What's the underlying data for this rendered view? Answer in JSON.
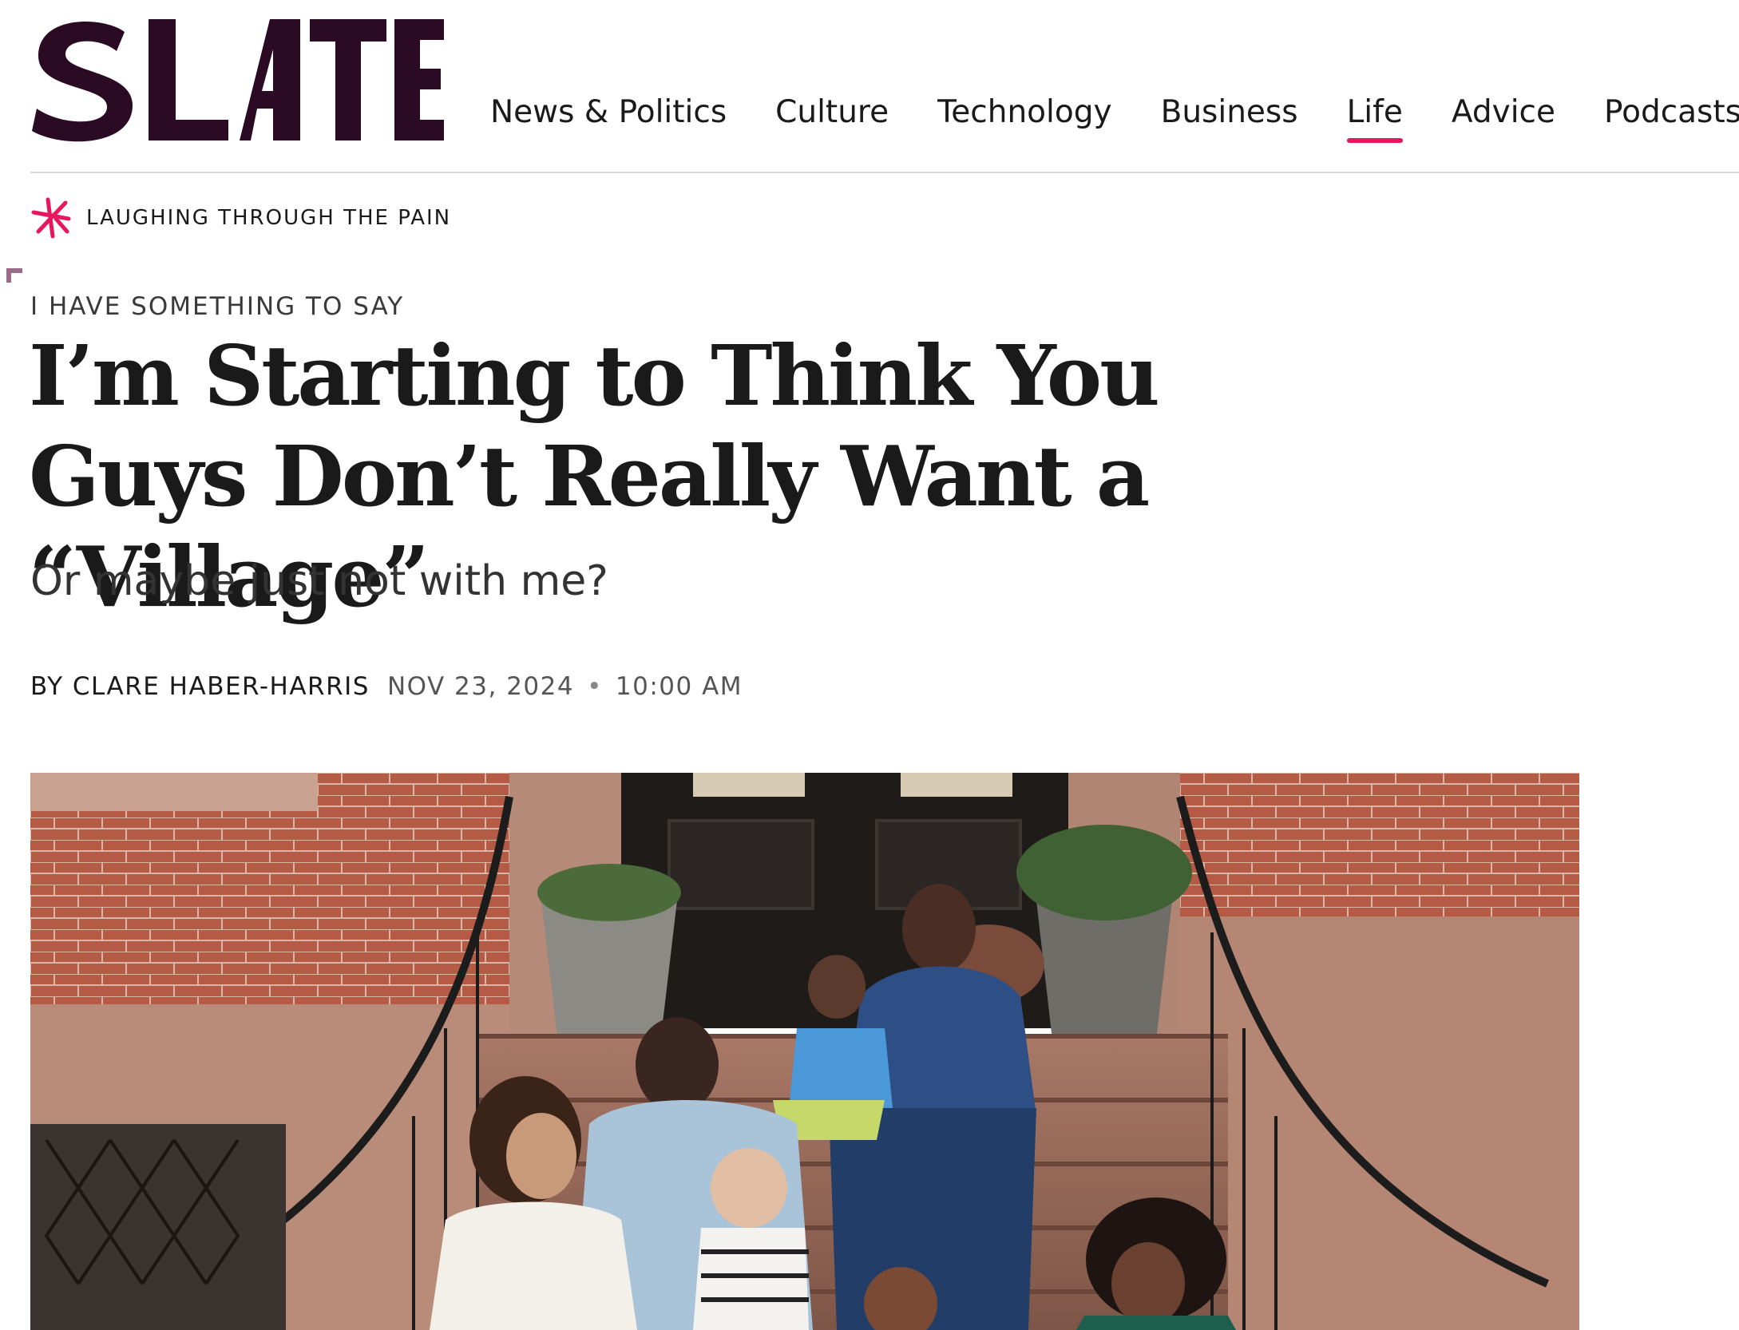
{
  "header": {
    "logo_text": "SLATE",
    "nav": [
      {
        "label": "News & Politics"
      },
      {
        "label": "Culture"
      },
      {
        "label": "Technology"
      },
      {
        "label": "Business"
      },
      {
        "label": "Life"
      },
      {
        "label": "Advice"
      },
      {
        "label": "Podcasts"
      }
    ],
    "active_nav": "Life"
  },
  "series": {
    "label": "LAUGHING THROUGH THE PAIN",
    "icon": "slate-asterisk-icon"
  },
  "article": {
    "kicker": "I HAVE SOMETHING TO SAY",
    "headline": "I’m Starting to Think You Guys Don’t Really Want a “Village”",
    "dek": "Or maybe just not with me?",
    "author": "BY CLARE HABER-HARRIS",
    "date": "NOV 23, 2024",
    "separator": "•",
    "time": "10:00 AM"
  },
  "hero_image": {
    "icon": "family-on-brownstone-stoop-photo"
  },
  "colors": {
    "brand": "#2b0a24",
    "accent": "#e8175d",
    "rule": "#d9d9d9"
  }
}
